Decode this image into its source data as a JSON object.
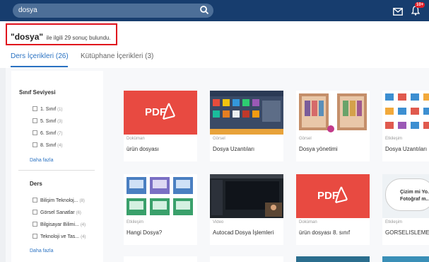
{
  "header": {
    "search_value": "dosya",
    "notification_badge": "10+"
  },
  "result": {
    "query": "\"dosya\"",
    "summary": "ile ilgili 29 sonuç bulundu."
  },
  "tabs": [
    {
      "label": "Ders İçerikleri (26)"
    },
    {
      "label": "Kütüphane İçerikleri (3)"
    }
  ],
  "filters": {
    "grade": {
      "title": "Sınıf Seviyesi",
      "options": [
        {
          "label": "1. Sınıf",
          "count": "(1)"
        },
        {
          "label": "5. Sınıf",
          "count": "(3)"
        },
        {
          "label": "6. Sınıf",
          "count": "(7)"
        },
        {
          "label": "8. Sınıf",
          "count": "(4)"
        }
      ],
      "more": "Daha fazla"
    },
    "course": {
      "title": "Ders",
      "options": [
        {
          "label": "Bilişim Teknoloj...",
          "count": "(8)"
        },
        {
          "label": "Görsel Sanatlar",
          "count": "(6)"
        },
        {
          "label": "Bilgisayar Bilimi...",
          "count": "(4)"
        },
        {
          "label": "Teknoloji ve Tas...",
          "count": "(4)"
        }
      ],
      "more": "Daha fazla"
    }
  },
  "cards": [
    {
      "type": "Doküman",
      "title": "ürün dosyası",
      "thumb": "pdf"
    },
    {
      "type": "Görsel",
      "title": "Dosya Uzantıları",
      "thumb": "icons"
    },
    {
      "type": "Görsel",
      "title": "Dosya yönetimi",
      "thumb": "wardrobe"
    },
    {
      "type": "Etkileşim",
      "title": "Dosya Uzantıları",
      "thumb": "grid"
    },
    {
      "type": "Etkileşim",
      "title": "Hangi Dosya?",
      "thumb": "tiles"
    },
    {
      "type": "Video",
      "title": "Autocad Dosya İşlemleri",
      "thumb": "video"
    },
    {
      "type": "Doküman",
      "title": "ürün dosyası 8. sınıf",
      "thumb": "pdf"
    },
    {
      "type": "Etkileşim",
      "title": "GORSELISLEME",
      "thumb": "bubble"
    }
  ],
  "bubble_text": "Çizim mi Yo... Fotoğraf m...",
  "pdf_label": "PDF",
  "colors": {
    "topbar": "#173d6e",
    "accent": "#2a72c2",
    "pdf_red": "#e84a41",
    "highlight_border": "#e0111d"
  }
}
